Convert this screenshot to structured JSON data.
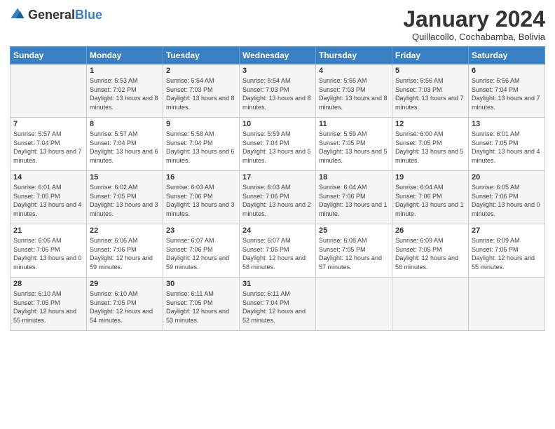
{
  "header": {
    "logo": {
      "general": "General",
      "blue": "Blue"
    },
    "title": "January 2024",
    "subtitle": "Quillacollo, Cochabamba, Bolivia"
  },
  "days_of_week": [
    "Sunday",
    "Monday",
    "Tuesday",
    "Wednesday",
    "Thursday",
    "Friday",
    "Saturday"
  ],
  "weeks": [
    [
      {
        "day": "",
        "content": ""
      },
      {
        "day": "1",
        "content": "Sunrise: 5:53 AM\nSunset: 7:02 PM\nDaylight: 13 hours\nand 8 minutes."
      },
      {
        "day": "2",
        "content": "Sunrise: 5:54 AM\nSunset: 7:03 PM\nDaylight: 13 hours\nand 8 minutes."
      },
      {
        "day": "3",
        "content": "Sunrise: 5:54 AM\nSunset: 7:03 PM\nDaylight: 13 hours\nand 8 minutes."
      },
      {
        "day": "4",
        "content": "Sunrise: 5:55 AM\nSunset: 7:03 PM\nDaylight: 13 hours\nand 8 minutes."
      },
      {
        "day": "5",
        "content": "Sunrise: 5:56 AM\nSunset: 7:03 PM\nDaylight: 13 hours\nand 7 minutes."
      },
      {
        "day": "6",
        "content": "Sunrise: 5:56 AM\nSunset: 7:04 PM\nDaylight: 13 hours\nand 7 minutes."
      }
    ],
    [
      {
        "day": "7",
        "content": "Sunrise: 5:57 AM\nSunset: 7:04 PM\nDaylight: 13 hours\nand 7 minutes."
      },
      {
        "day": "8",
        "content": "Sunrise: 5:57 AM\nSunset: 7:04 PM\nDaylight: 13 hours\nand 6 minutes."
      },
      {
        "day": "9",
        "content": "Sunrise: 5:58 AM\nSunset: 7:04 PM\nDaylight: 13 hours\nand 6 minutes."
      },
      {
        "day": "10",
        "content": "Sunrise: 5:59 AM\nSunset: 7:04 PM\nDaylight: 13 hours\nand 5 minutes."
      },
      {
        "day": "11",
        "content": "Sunrise: 5:59 AM\nSunset: 7:05 PM\nDaylight: 13 hours\nand 5 minutes."
      },
      {
        "day": "12",
        "content": "Sunrise: 6:00 AM\nSunset: 7:05 PM\nDaylight: 13 hours\nand 5 minutes."
      },
      {
        "day": "13",
        "content": "Sunrise: 6:01 AM\nSunset: 7:05 PM\nDaylight: 13 hours\nand 4 minutes."
      }
    ],
    [
      {
        "day": "14",
        "content": "Sunrise: 6:01 AM\nSunset: 7:05 PM\nDaylight: 13 hours\nand 4 minutes."
      },
      {
        "day": "15",
        "content": "Sunrise: 6:02 AM\nSunset: 7:05 PM\nDaylight: 13 hours\nand 3 minutes."
      },
      {
        "day": "16",
        "content": "Sunrise: 6:03 AM\nSunset: 7:06 PM\nDaylight: 13 hours\nand 3 minutes."
      },
      {
        "day": "17",
        "content": "Sunrise: 6:03 AM\nSunset: 7:06 PM\nDaylight: 13 hours\nand 2 minutes."
      },
      {
        "day": "18",
        "content": "Sunrise: 6:04 AM\nSunset: 7:06 PM\nDaylight: 13 hours\nand 1 minute."
      },
      {
        "day": "19",
        "content": "Sunrise: 6:04 AM\nSunset: 7:06 PM\nDaylight: 13 hours\nand 1 minute."
      },
      {
        "day": "20",
        "content": "Sunrise: 6:05 AM\nSunset: 7:06 PM\nDaylight: 13 hours\nand 0 minutes."
      }
    ],
    [
      {
        "day": "21",
        "content": "Sunrise: 6:06 AM\nSunset: 7:06 PM\nDaylight: 13 hours\nand 0 minutes."
      },
      {
        "day": "22",
        "content": "Sunrise: 6:06 AM\nSunset: 7:06 PM\nDaylight: 12 hours\nand 59 minutes."
      },
      {
        "day": "23",
        "content": "Sunrise: 6:07 AM\nSunset: 7:06 PM\nDaylight: 12 hours\nand 59 minutes."
      },
      {
        "day": "24",
        "content": "Sunrise: 6:07 AM\nSunset: 7:05 PM\nDaylight: 12 hours\nand 58 minutes."
      },
      {
        "day": "25",
        "content": "Sunrise: 6:08 AM\nSunset: 7:05 PM\nDaylight: 12 hours\nand 57 minutes."
      },
      {
        "day": "26",
        "content": "Sunrise: 6:09 AM\nSunset: 7:05 PM\nDaylight: 12 hours\nand 56 minutes."
      },
      {
        "day": "27",
        "content": "Sunrise: 6:09 AM\nSunset: 7:05 PM\nDaylight: 12 hours\nand 55 minutes."
      }
    ],
    [
      {
        "day": "28",
        "content": "Sunrise: 6:10 AM\nSunset: 7:05 PM\nDaylight: 12 hours\nand 55 minutes."
      },
      {
        "day": "29",
        "content": "Sunrise: 6:10 AM\nSunset: 7:05 PM\nDaylight: 12 hours\nand 54 minutes."
      },
      {
        "day": "30",
        "content": "Sunrise: 6:11 AM\nSunset: 7:05 PM\nDaylight: 12 hours\nand 53 minutes."
      },
      {
        "day": "31",
        "content": "Sunrise: 6:11 AM\nSunset: 7:04 PM\nDaylight: 12 hours\nand 52 minutes."
      },
      {
        "day": "",
        "content": ""
      },
      {
        "day": "",
        "content": ""
      },
      {
        "day": "",
        "content": ""
      }
    ]
  ]
}
